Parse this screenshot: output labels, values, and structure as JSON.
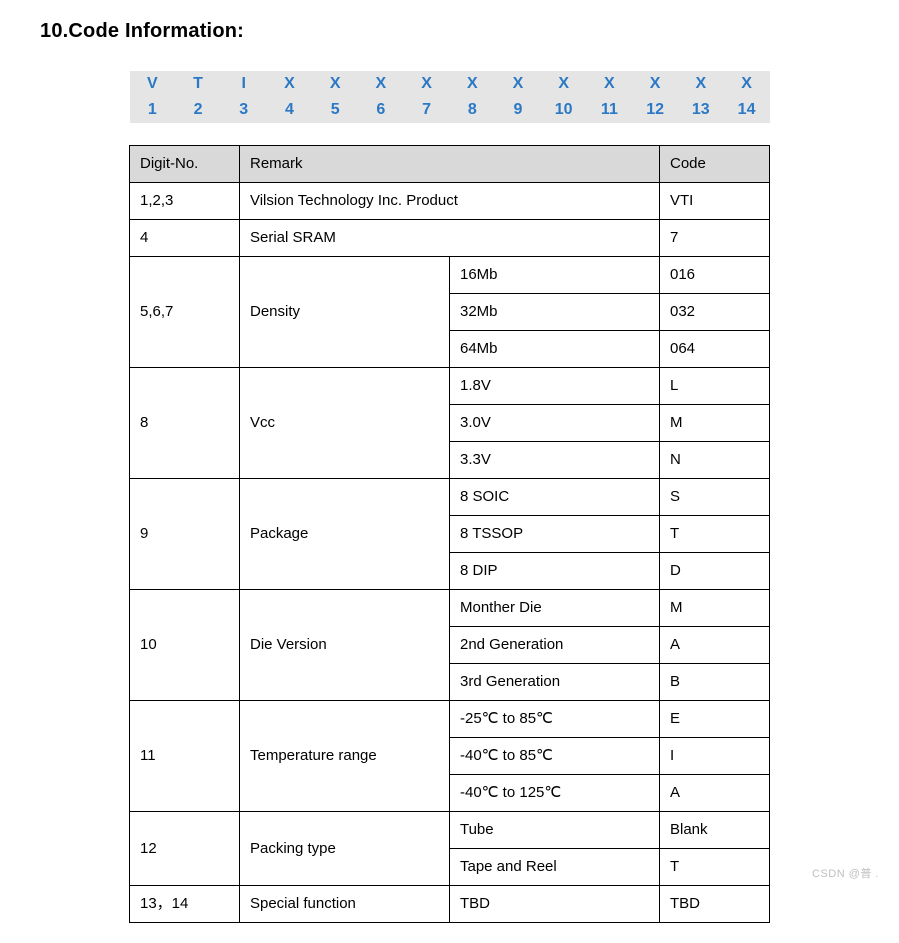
{
  "section_title": "10.Code Information:",
  "code_strip": {
    "letters": [
      "V",
      "T",
      "I",
      "X",
      "X",
      "X",
      "X",
      "X",
      "X",
      "X",
      "X",
      "X",
      "X",
      "X"
    ],
    "numbers": [
      "1",
      "2",
      "3",
      "4",
      "5",
      "6",
      "7",
      "8",
      "9",
      "10",
      "11",
      "12",
      "13",
      "14"
    ]
  },
  "table": {
    "header": {
      "digit": "Digit-No.",
      "remark": "Remark",
      "code": "Code"
    },
    "rows_simple": [
      {
        "digit": "1,2,3",
        "remark": "Vilsion Technology Inc. Product",
        "code": "VTI"
      },
      {
        "digit": "4",
        "remark": "Serial SRAM",
        "code": "7"
      }
    ],
    "density": {
      "digit": "5,6,7",
      "label": "Density",
      "items": [
        {
          "val": "16Mb",
          "code": "016"
        },
        {
          "val": "32Mb",
          "code": "032"
        },
        {
          "val": "64Mb",
          "code": "064"
        }
      ]
    },
    "vcc": {
      "digit": "8",
      "label": "Vcc",
      "items": [
        {
          "val": "1.8V",
          "code": "L"
        },
        {
          "val": "3.0V",
          "code": "M"
        },
        {
          "val": "3.3V",
          "code": "N"
        }
      ]
    },
    "package": {
      "digit": "9",
      "label": "Package",
      "items": [
        {
          "val": "8 SOIC",
          "code": "S"
        },
        {
          "val": "8 TSSOP",
          "code": "T"
        },
        {
          "val": "8 DIP",
          "code": "D"
        }
      ]
    },
    "die_version": {
      "digit": "10",
      "label": "Die Version",
      "items": [
        {
          "val": "Monther Die",
          "code": "M"
        },
        {
          "val": "2nd Generation",
          "code": "A"
        },
        {
          "val": "3rd Generation",
          "code": "B"
        }
      ]
    },
    "temperature": {
      "digit": "11",
      "label": "Temperature range",
      "items": [
        {
          "val": "-25℃ to 85℃",
          "code": "E"
        },
        {
          "val": "-40℃ to 85℃",
          "code": "I"
        },
        {
          "val": "-40℃ to 125℃",
          "code": "A"
        }
      ]
    },
    "packing": {
      "digit": "12",
      "label": "Packing type",
      "items": [
        {
          "val": "Tube",
          "code": "Blank"
        },
        {
          "val": "Tape and Reel",
          "code": "T"
        }
      ]
    },
    "special": {
      "digit": "13，14",
      "remark": "Special function",
      "val": "TBD",
      "code": "TBD"
    }
  },
  "watermark": "CSDN @普 ."
}
